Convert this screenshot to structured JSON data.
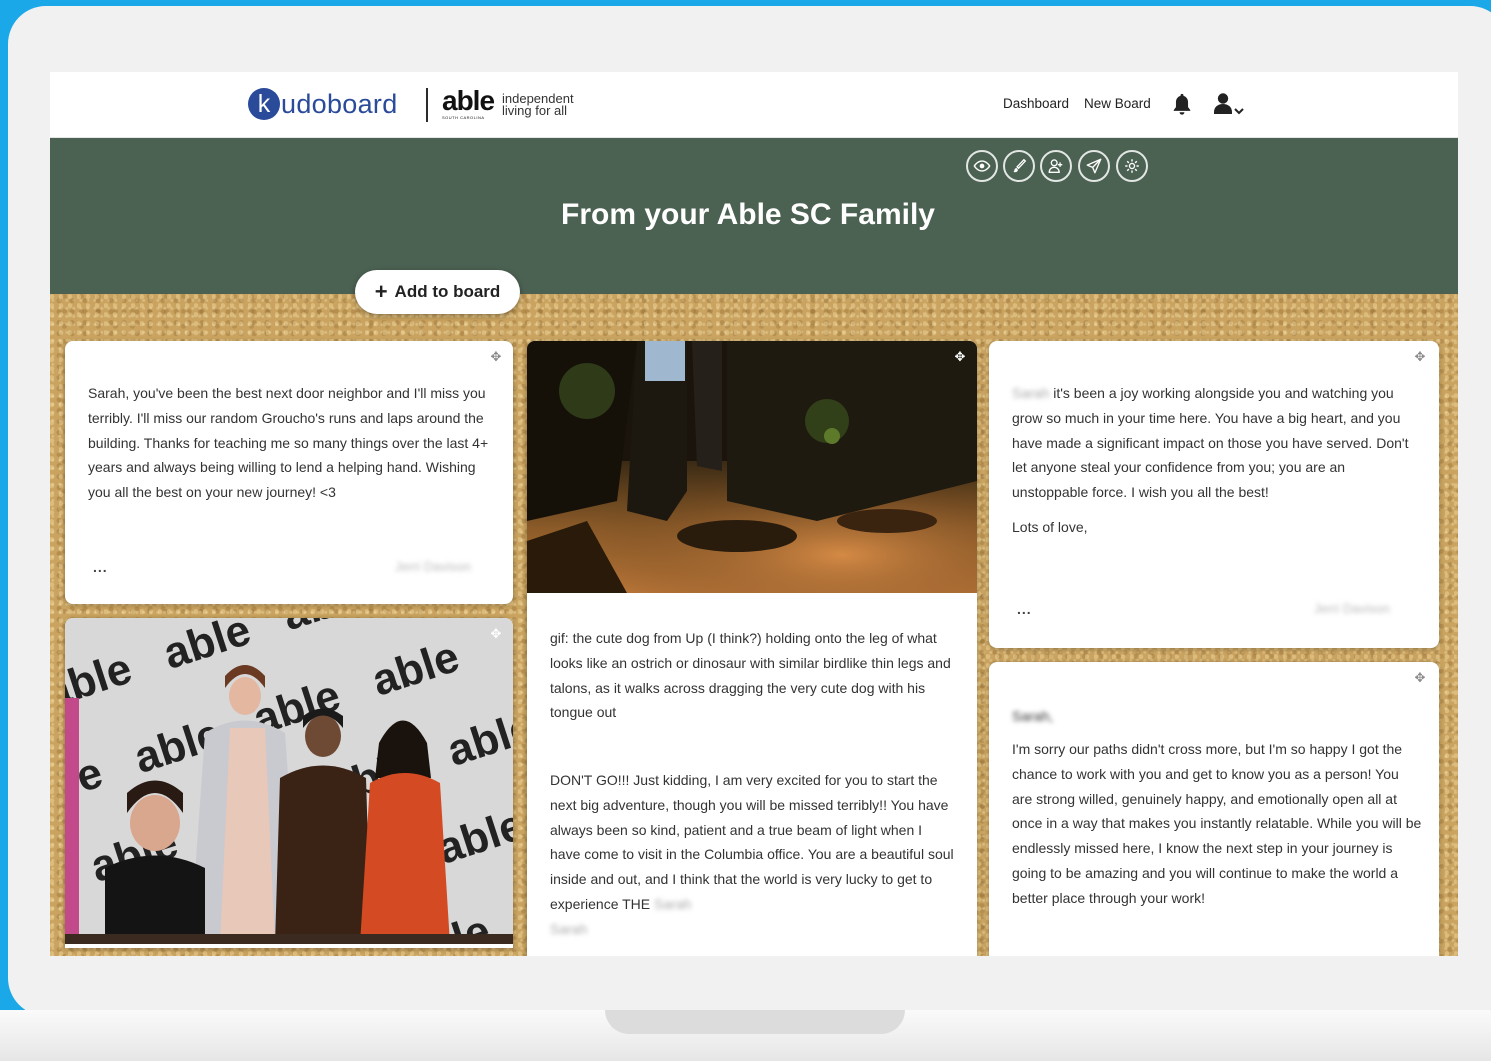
{
  "nav": {
    "logo_text": "udoboard",
    "logo_k": "k",
    "partner_name": "able",
    "partner_small": "SOUTH CAROLINA",
    "partner_tagline": "independent living for all",
    "dashboard": "Dashboard",
    "new_board": "New Board",
    "bell_icon": "bell-icon",
    "user_icon": "user-icon"
  },
  "colors": {
    "brand_blue": "#2a4a9a",
    "header_green": "#4b6152",
    "cork": "#c9a35f",
    "outer_bg": "#1aa8e8"
  },
  "toolbar": {
    "icons": [
      "eye-icon",
      "brush-icon",
      "add-user-icon",
      "send-icon",
      "gear-icon"
    ]
  },
  "board": {
    "title": "From your Able SC Family",
    "add_button": "Add to board",
    "add_plus": "+"
  },
  "posts": {
    "p1": {
      "text": "Sarah, you've been the best next door neighbor and I'll miss you terribly.  I'll miss our random Groucho's runs and laps around the building. Thanks for teaching me so many things over the last 4+ years and always being willing to lend a helping hand. Wishing you all the best on your new journey! <3",
      "more": "...",
      "signature": "Jerri Davison"
    },
    "p2": {
      "caption": "gif: the cute dog from Up (I think?) holding onto the leg of what looks like an ostrich or dinosaur with similar birdlike thin legs and talons, as it walks across dragging the very cute dog with his tongue out",
      "text": "DON'T GO!!! Just kidding, I am very excited for you to start the next big adventure, though you will be missed terribly!! You have always been so kind, patient and a true beam of light when I have come to visit in the Columbia office. You are a beautiful soul inside and out, and I think that the world is very lucky to get to experience THE",
      "blur_name_1": "Sarah",
      "blur_name_2": "Sarah"
    },
    "p3": {
      "blur_name": "Sarah",
      "text": " it's been a joy working alongside you and watching you grow so much in your time here. You have a big heart, and you have made a significant impact on those you have served. Don't let anyone steal your confidence from you; you are an unstoppable force.  I wish you all the best!",
      "closing": "Lots of love,",
      "more": "...",
      "signature": "Jerri Davison"
    },
    "p4": {
      "greeting": "Sarah,",
      "text": "I'm sorry our paths didn't cross more, but I'm so happy I got the chance to work with you and get to know you as a person! You are strong willed, genuinely happy, and emotionally open all at once in a way that makes you instantly relatable. While you will be endlessly missed here, I know the next step in your journey is going to be amazing and you will continue to make the world a better place through your work!"
    },
    "move_icon": "✥"
  },
  "backdrop": {
    "word": "able",
    "sub": "SOUTH CAROLINA"
  }
}
